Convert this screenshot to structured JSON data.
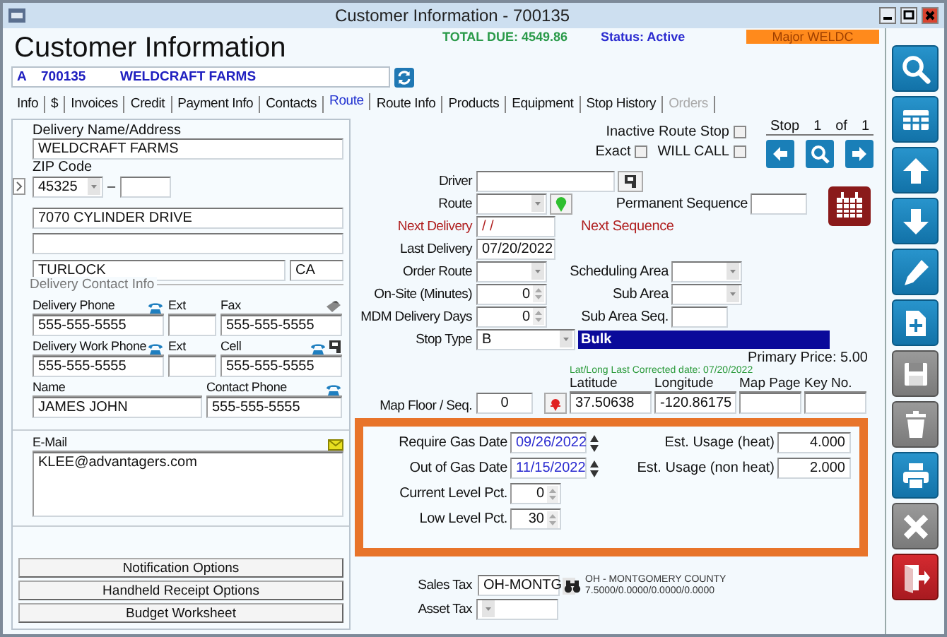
{
  "window": {
    "title": "Customer Information - 700135"
  },
  "header": {
    "title": "Customer Information",
    "total_due": "TOTAL DUE:  4549.86",
    "status": "Status: Active",
    "tag": "Major WELDC"
  },
  "customer": {
    "type": "A",
    "number": "700135",
    "name": "WELDCRAFT FARMS"
  },
  "tabs": [
    {
      "label": "Info",
      "selected": false,
      "disabled": false
    },
    {
      "label": "$",
      "selected": false,
      "disabled": false
    },
    {
      "label": "Invoices",
      "selected": false,
      "disabled": false
    },
    {
      "label": "Credit",
      "selected": false,
      "disabled": false
    },
    {
      "label": "Payment Info",
      "selected": false,
      "disabled": false
    },
    {
      "label": "Contacts",
      "selected": false,
      "disabled": false
    },
    {
      "label": "Route",
      "selected": true,
      "disabled": false
    },
    {
      "label": "Route Info",
      "selected": false,
      "disabled": false
    },
    {
      "label": "Products",
      "selected": false,
      "disabled": false
    },
    {
      "label": "Equipment",
      "selected": false,
      "disabled": false
    },
    {
      "label": "Stop History",
      "selected": false,
      "disabled": false
    },
    {
      "label": "Orders",
      "selected": false,
      "disabled": true
    }
  ],
  "address": {
    "label": "Delivery Name/Address",
    "name": "WELDCRAFT FARMS",
    "zip_label": "ZIP Code",
    "zip": "45325",
    "zip_separator": "–",
    "street": "7070 CYLINDER DRIVE",
    "city": "TURLOCK",
    "state": "CA"
  },
  "contact": {
    "group": "Delivery Contact Info",
    "fields": [
      {
        "kind": "phone",
        "label": "Delivery Phone",
        "value": "555-555-5555"
      },
      {
        "kind": "ext",
        "label": "Ext"
      },
      {
        "kind": "fax",
        "label": "Fax",
        "value": "555-555-5555"
      },
      {
        "kind": "phone",
        "label": "Delivery Work Phone",
        "value": "555-555-5555"
      },
      {
        "kind": "ext",
        "label": "Ext"
      },
      {
        "kind": "cell",
        "label": "Cell",
        "value": "555-555-5555"
      },
      {
        "kind": "name",
        "label": "Name",
        "value": "JAMES JOHN"
      },
      {
        "kind": "contact_phone",
        "label": "Contact Phone",
        "value": "555-555-5555"
      }
    ]
  },
  "email": {
    "label": "E-Mail",
    "value": "KLEE@advantagers.com"
  },
  "side_buttons": [
    "Notification Options",
    "Handheld Receipt Options",
    "Budget Worksheet"
  ],
  "flags": [
    {
      "label": "Inactive Route Stop",
      "checked": false
    },
    {
      "label": "Exact",
      "checked": false
    },
    {
      "label": "WILL CALL",
      "checked": false
    }
  ],
  "stop_nav": {
    "label": "Stop",
    "current": "1",
    "of": "of",
    "total": "1"
  },
  "route": {
    "driver_label": "Driver",
    "route_label": "Route",
    "perm_seq_label": "Permanent Sequence",
    "next_delivery_label": "Next Delivery",
    "next_delivery": "/ /",
    "next_sequence_label": "Next Sequence",
    "last_delivery_label": "Last Delivery",
    "last_delivery": "07/20/2022",
    "order_route_label": "Order Route",
    "scheduling_area_label": "Scheduling Area",
    "on_site_label": "On-Site (Minutes)",
    "on_site": "0",
    "sub_area_label": "Sub Area",
    "mdm_label": "MDM Delivery Days",
    "mdm": "0",
    "sub_area_seq_label": "Sub Area Seq.",
    "stop_type_label": "Stop Type",
    "stop_type": "B",
    "stop_type_desc": "Bulk",
    "primary_price": "Primary Price: 5.00",
    "latlong_note": "Lat/Long Last Corrected date:  07/20/2022"
  },
  "map": {
    "floor_label": "Map Floor / Seq.",
    "floor": "0",
    "latitude_label": "Latitude",
    "latitude": "37.50638",
    "longitude_label": "Longitude",
    "longitude": "-120.86175",
    "page_label": "Map Page",
    "key_label": "Key No."
  },
  "gas": {
    "require_label": "Require Gas Date",
    "require": "09/26/2022",
    "out_label": "Out of Gas Date",
    "out": "11/15/2022",
    "current_label": "Current Level Pct.",
    "current": "0",
    "low_label": "Low Level Pct.",
    "low": "30",
    "heat_label": "Est. Usage (heat)",
    "heat": "4.000",
    "nonheat_label": "Est. Usage (non heat)",
    "nonheat": "2.000"
  },
  "tax": {
    "sales_label": "Sales Tax",
    "sales": "OH-MONTG",
    "county": "OH - MONTGOMERY COUNTY",
    "rates": "7.5000/0.0000/0.0000/0.0000",
    "asset_label": "Asset Tax"
  },
  "toolbar": [
    {
      "kind": "search",
      "disabled": false
    },
    {
      "kind": "grid",
      "disabled": false
    },
    {
      "kind": "up",
      "disabled": false
    },
    {
      "kind": "down",
      "disabled": false
    },
    {
      "kind": "edit",
      "disabled": false
    },
    {
      "kind": "add",
      "disabled": false
    },
    {
      "kind": "save",
      "disabled": true
    },
    {
      "kind": "delete",
      "disabled": true
    },
    {
      "kind": "print",
      "disabled": false
    },
    {
      "kind": "cancel",
      "disabled": true
    },
    {
      "kind": "exit",
      "disabled": false
    }
  ]
}
